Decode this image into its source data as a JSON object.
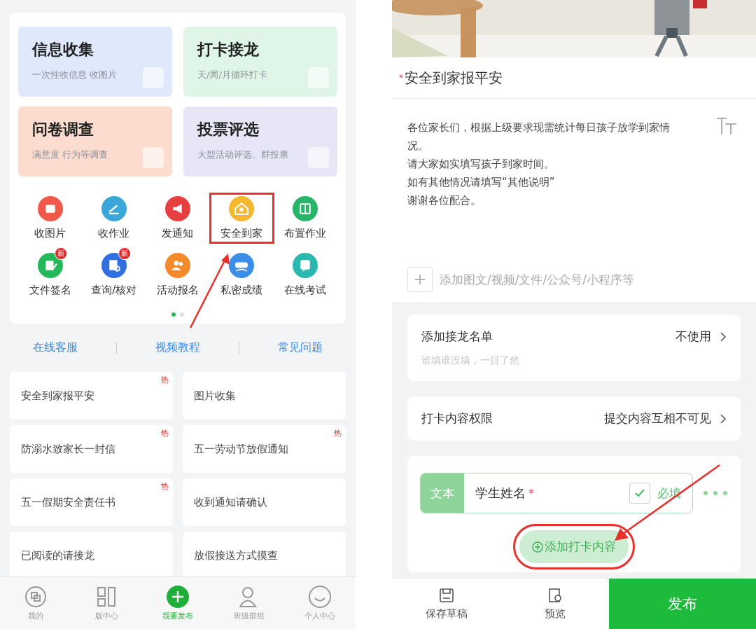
{
  "home": {
    "feature_cards": [
      {
        "title": "信息收集",
        "subtitle": "一次性收信息 收图片",
        "color": "#dfe9fb"
      },
      {
        "title": "打卡接龙",
        "subtitle": "天/周/月循环打卡",
        "color": "#dff5e8"
      },
      {
        "title": "问卷调查",
        "subtitle": "满意度 行为等调查",
        "color": "#fbdccf"
      },
      {
        "title": "投票评选",
        "subtitle": "大型活动评选、群投票",
        "color": "#e6e6f7"
      }
    ],
    "tools": [
      {
        "label": "收图片",
        "color": "#f0584a",
        "highlighted": false
      },
      {
        "label": "收作业",
        "color": "#3aa7d8",
        "highlighted": false
      },
      {
        "label": "发通知",
        "color": "#e84040",
        "highlighted": false
      },
      {
        "label": "安全到家",
        "color": "#f5b72e",
        "highlighted": true
      },
      {
        "label": "布置作业",
        "color": "#27b56a",
        "highlighted": false
      },
      {
        "label": "文件签名",
        "color": "#24b85a",
        "badge": "新",
        "highlighted": false
      },
      {
        "label": "查询/核对",
        "color": "#2f6fe0",
        "badge": "新",
        "highlighted": false
      },
      {
        "label": "活动报名",
        "color": "#f58a2a",
        "highlighted": false
      },
      {
        "label": "私密成绩",
        "color": "#3b8fe8",
        "highlighted": false
      },
      {
        "label": "在线考试",
        "color": "#2ab8b0",
        "highlighted": false
      }
    ],
    "page_dots": [
      {
        "selected": true
      },
      {
        "selected": false
      }
    ],
    "links": [
      "在线客服",
      "视频教程",
      "常见问题"
    ],
    "templates": [
      {
        "title": "安全到家报平安",
        "badge": "热"
      },
      {
        "title": "图片收集"
      },
      {
        "title": "防溺水致家长一封信",
        "badge": "热"
      },
      {
        "title": "五一劳动节放假通知",
        "badge": "热"
      },
      {
        "title": "五一假期安全责任书",
        "badge": "热"
      },
      {
        "title": "收到通知请确认"
      },
      {
        "title": "已阅读的请接龙"
      },
      {
        "title": "放假接送方式摸查"
      }
    ],
    "bottom_nav": [
      {
        "label": "我的",
        "selected": false
      },
      {
        "label": "版中心",
        "selected": false
      },
      {
        "label": "我要发布",
        "selected": true
      },
      {
        "label": "班级群组",
        "selected": false
      },
      {
        "label": "个人中心",
        "selected": false
      }
    ]
  },
  "editor": {
    "required_mark": "*",
    "title": "安全到家报平安",
    "description": [
      "各位家长们，根据上级要求现需统计每日孩子放学到家情况。",
      "请大家如实填写孩子到家时间。",
      "如有其他情况请填写“其他说明”",
      "谢谢各位配合。"
    ],
    "attach_placeholder": "添加图文/视频/文件/公众号/小程序等",
    "settings": [
      {
        "label": "添加接龙名单",
        "hint": "谁填谁没填，一目了然",
        "value": "不使用"
      },
      {
        "label": "打卡内容权限",
        "value": "提交内容互相不可见"
      }
    ],
    "field": {
      "type": "文本",
      "name": "学生姓名",
      "required_mark": "*",
      "required": true,
      "required_label": "必填"
    },
    "add_button": {
      "label": "添加打卡内容",
      "highlighted": true
    },
    "actions": [
      {
        "label": "保存草稿",
        "kind": "save"
      },
      {
        "label": "预览",
        "kind": "preview"
      }
    ],
    "publish": "发布"
  }
}
